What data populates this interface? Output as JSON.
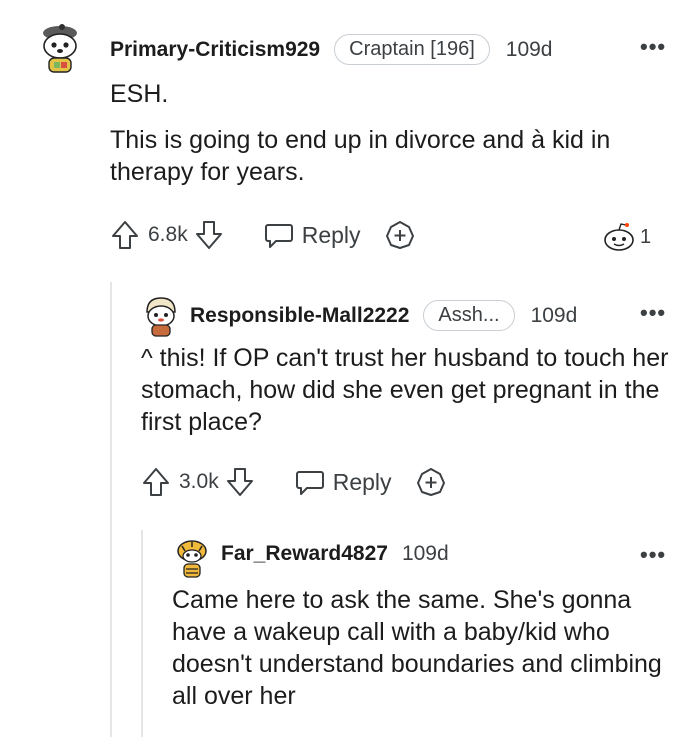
{
  "comments": [
    {
      "username": "Primary-Criticism929",
      "flair": "Craptain [196]",
      "age": "109d",
      "body": [
        "ESH.",
        "This is going to end up in divorce and à kid in therapy for years."
      ],
      "votes": "6.8k",
      "reply_label": "Reply",
      "award_count": "1",
      "avatar_icon": "snoo-avatar-cat-hat"
    },
    {
      "username": "Responsible-Mall2222",
      "flair": "Assh...",
      "age": "109d",
      "body": [
        "^ this! If OP can't trust her husband to touch her stomach, how did she even get pregnant in the first place?"
      ],
      "votes": "3.0k",
      "reply_label": "Reply",
      "avatar_icon": "snoo-avatar-helmet"
    },
    {
      "username": "Far_Reward4827",
      "age": "109d",
      "body": [
        "Came here to ask the same. She's gonna have a wakeup call with a baby/kid who doesn't understand boundaries and climbing all over her"
      ],
      "avatar_icon": "snoo-avatar-tiger"
    }
  ],
  "icons": {
    "upvote": "arrow-up-icon",
    "downvote": "arrow-down-icon",
    "reply": "speech-bubble-icon",
    "award": "award-plus-icon",
    "more": "ellipsis-icon"
  },
  "colors": {
    "text": "#1c1c1c",
    "meta": "#3c4043",
    "thread_line": "#e5e5e5",
    "flair_border": "#c9cfd4"
  }
}
